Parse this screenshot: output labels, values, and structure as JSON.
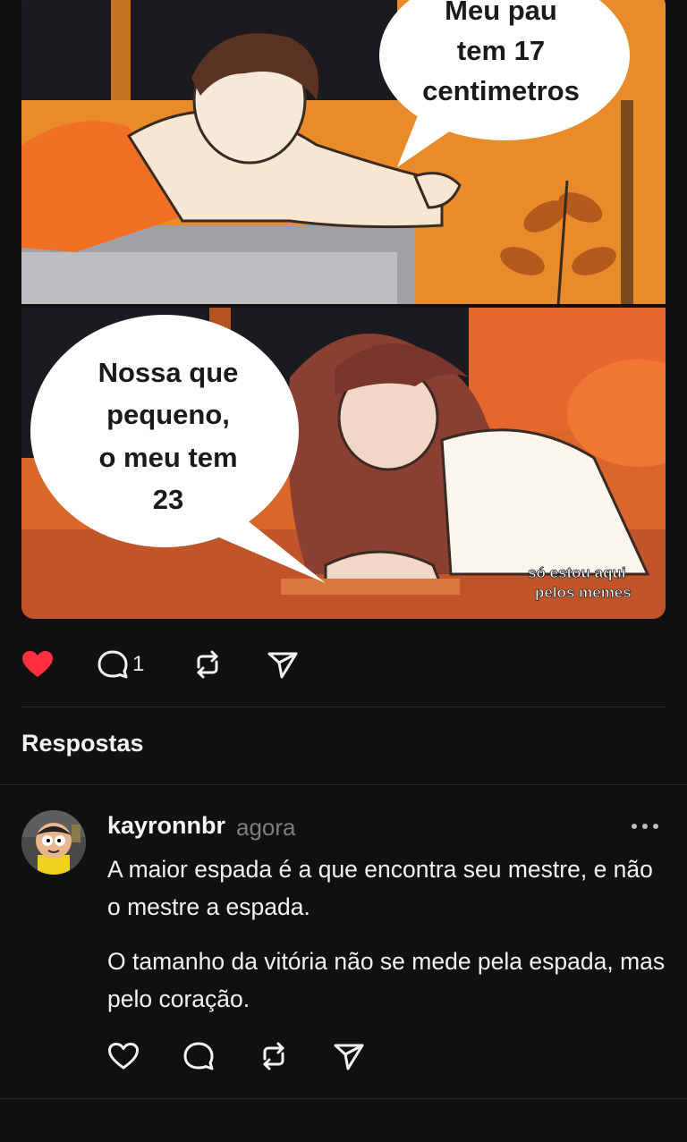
{
  "post": {
    "meme": {
      "bubble_top": [
        "Meu pau",
        "tem 17",
        "centimetros"
      ],
      "bubble_bottom": [
        "Nossa que",
        "pequeno,",
        "o meu tem",
        "23"
      ],
      "watermark": [
        "só estou aqui",
        "pelos memes"
      ]
    },
    "actions": {
      "like_icon": "heart-filled",
      "like_color": "#ff3040",
      "reply_icon": "speech-bubble",
      "reply_count": "1",
      "repost_icon": "repost-arrows",
      "share_icon": "paper-plane"
    }
  },
  "replies": {
    "title": "Respostas",
    "items": [
      {
        "username": "kayronnbr",
        "time": "agora",
        "paragraphs": [
          "A maior espada é a que encontra seu mestre, e não o mestre a espada.",
          "O tamanho da vitória não se mede pela espada, mas pelo coração."
        ],
        "more_icon": "more-horizontal",
        "actions": [
          "heart-outline",
          "speech-bubble",
          "repost-arrows",
          "paper-plane"
        ]
      }
    ]
  }
}
